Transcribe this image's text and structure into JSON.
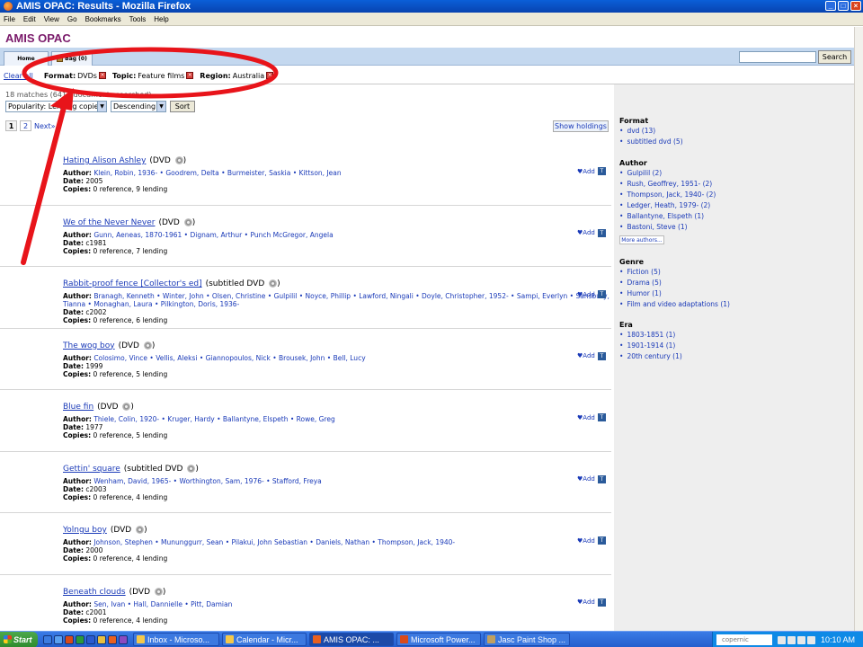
{
  "window": {
    "title": "AMIS OPAC: Results - Mozilla Firefox",
    "minimize_glyph": "_",
    "maximize_glyph": "□",
    "close_glyph": "×"
  },
  "menu": [
    "File",
    "Edit",
    "View",
    "Go",
    "Bookmarks",
    "Tools",
    "Help"
  ],
  "site": {
    "title": "AMIS OPAC",
    "tabs": {
      "home": "Home",
      "bag": "Bag (0)"
    },
    "search_button": "Search",
    "search_value": ""
  },
  "filters": {
    "clear_all": "Clear all",
    "items": [
      {
        "label": "Format:",
        "value": "DVDs"
      },
      {
        "label": "Topic:",
        "value": "Feature films"
      },
      {
        "label": "Region:",
        "value": "Australia"
      }
    ],
    "remove_glyph": "×"
  },
  "results_meta": {
    "matches": "18 matches (6414 documents searched)",
    "sort_by": "Popularity: Lending copies",
    "sort_order": "Descending",
    "sort_button": "Sort",
    "pages": [
      "1",
      "2"
    ],
    "next": "Next»",
    "show_holdings": "Show holdings"
  },
  "results": [
    {
      "title": "Hating Alison Ashley",
      "format": "(DVD",
      "author_label": "Author:",
      "authors": "Klein, Robin, 1936- • Goodrem, Delta • Burmeister, Saskia • Kittson, Jean",
      "authors_2": "",
      "date_label": "Date:",
      "date": "2005",
      "copies_label": "Copies:",
      "copies": "0 reference, 9 lending"
    },
    {
      "title": "We of the Never Never",
      "format": "(DVD",
      "author_label": "Author:",
      "authors": "Gunn, Aeneas, 1870-1961 • Dignam, Arthur • Punch McGregor, Angela",
      "authors_2": "",
      "date_label": "Date:",
      "date": "c1981",
      "copies_label": "Copies:",
      "copies": "0 reference, 7 lending"
    },
    {
      "title": "Rabbit-proof fence [Collector's ed]",
      "format": "(subtitled DVD",
      "author_label": "Author:",
      "authors": "Branagh, Kenneth • Winter, John • Olsen, Christine • Gulpilil • Noyce, Phillip • Lawford, Ningali • Doyle, Christopher, 1952- • Sampi, Everlyn • Sansbury,",
      "authors_2": "Tianna • Monaghan, Laura • Pilkington, Doris, 1936-",
      "date_label": "Date:",
      "date": "c2002",
      "copies_label": "Copies:",
      "copies": "0 reference, 6 lending"
    },
    {
      "title": "The wog boy",
      "format": "(DVD",
      "author_label": "Author:",
      "authors": "Colosimo, Vince • Vellis, Aleksi • Giannopoulos, Nick • Brousek, John • Bell, Lucy",
      "authors_2": "",
      "date_label": "Date:",
      "date": "1999",
      "copies_label": "Copies:",
      "copies": "0 reference, 5 lending"
    },
    {
      "title": "Blue fin",
      "format": "(DVD",
      "author_label": "Author:",
      "authors": "Thiele, Colin, 1920- • Kruger, Hardy • Ballantyne, Elspeth • Rowe, Greg",
      "authors_2": "",
      "date_label": "Date:",
      "date": "1977",
      "copies_label": "Copies:",
      "copies": "0 reference, 5 lending"
    },
    {
      "title": "Gettin' square",
      "format": "(subtitled DVD",
      "author_label": "Author:",
      "authors": "Wenham, David, 1965- • Worthington, Sam, 1976- • Stafford, Freya",
      "authors_2": "",
      "date_label": "Date:",
      "date": "c2003",
      "copies_label": "Copies:",
      "copies": "0 reference, 4 lending"
    },
    {
      "title": "Yolngu boy",
      "format": "(DVD",
      "author_label": "Author:",
      "authors": "Johnson, Stephen • Mununggurr, Sean • Pilakui, John Sebastian • Daniels, Nathan • Thompson, Jack, 1940-",
      "authors_2": "",
      "date_label": "Date:",
      "date": "2000",
      "copies_label": "Copies:",
      "copies": "0 reference, 4 lending"
    },
    {
      "title": "Beneath clouds",
      "format": "(DVD",
      "author_label": "Author:",
      "authors": "Sen, Ivan • Hall, Dannielle • Pitt, Damian",
      "authors_2": "",
      "date_label": "Date:",
      "date": "c2001",
      "copies_label": "Copies:",
      "copies": "0 reference, 4 lending"
    }
  ],
  "result_actions": {
    "add": "♥Add",
    "t": "T",
    "close_paren": ")"
  },
  "sidebar": {
    "format": {
      "heading": "Format",
      "items": [
        "dvd (13)",
        "subtitled dvd (5)"
      ]
    },
    "author": {
      "heading": "Author",
      "items": [
        "Gulpilil (2)",
        "Rush, Geoffrey, 1951- (2)",
        "Thompson, Jack, 1940- (2)",
        "Ledger, Heath, 1979- (2)",
        "Ballantyne, Elspeth (1)",
        "Bastoni, Steve (1)"
      ],
      "more": "More authors..."
    },
    "genre": {
      "heading": "Genre",
      "items": [
        "Fiction (5)",
        "Drama (5)",
        "Humor (1)",
        "Film and video adaptations (1)"
      ]
    },
    "era": {
      "heading": "Era",
      "items": [
        "1803-1851 (1)",
        "1901-1914 (1)",
        "20th century (1)"
      ]
    }
  },
  "taskbar": {
    "start": "Start",
    "tasks": [
      "Inbox - Microso...",
      "Calendar - Micr...",
      "AMIS OPAC: ...",
      "Microsoft Power...",
      "Jasc Paint Shop ..."
    ],
    "search_placeholder": "copernic",
    "clock": "10:10 AM"
  },
  "colors": {
    "annotation": "#e8141a",
    "site_title": "#7a1a6a",
    "link": "#1a3ab8",
    "tab_bar": "#c4d8ef"
  }
}
